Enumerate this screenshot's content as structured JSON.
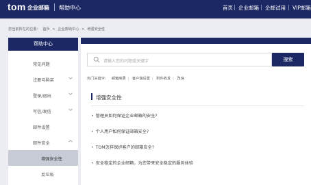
{
  "header": {
    "brand_tom": "tom",
    "brand_mail": "企业邮箱",
    "brand_help": "帮助中心",
    "nav": [
      "首页",
      "企业邮箱",
      "企邮试用",
      "VIP邮箱"
    ]
  },
  "breadcrumb": {
    "prefix": "您当前所在的位置：",
    "items": [
      "首页",
      ">",
      "企业帮助中心",
      ">",
      "增强安全性"
    ]
  },
  "sidebar": {
    "title": "帮助中心",
    "items": [
      {
        "label": "常见问题"
      },
      {
        "label": "注册与购买"
      },
      {
        "label": "登录/退出"
      },
      {
        "label": "写信/发信"
      },
      {
        "label": "邮件设置"
      },
      {
        "label": "邮件安全"
      },
      {
        "label": "增强安全性"
      },
      {
        "label": "反垃圾"
      }
    ]
  },
  "search": {
    "placeholder": "请输入您的问题或关键字",
    "button": "搜索",
    "hot_label": "热门关键字：",
    "hot_terms": [
      "邮箱续费",
      "客户端设置",
      "附件收发",
      "改信"
    ]
  },
  "content": {
    "title": "增强安全性",
    "questions": [
      "管理员如何保证企业邮箱的安全?",
      "个人用户如何保证邮箱安全?",
      "TOM怎样保护客户的邮箱安全?",
      "安全稳定的企业邮箱，为您带来安全稳定的服务体验"
    ]
  },
  "colors": {
    "accent": "#1c2864",
    "active_item": "#c7cbd6",
    "page_bg": "#ebedf2"
  }
}
